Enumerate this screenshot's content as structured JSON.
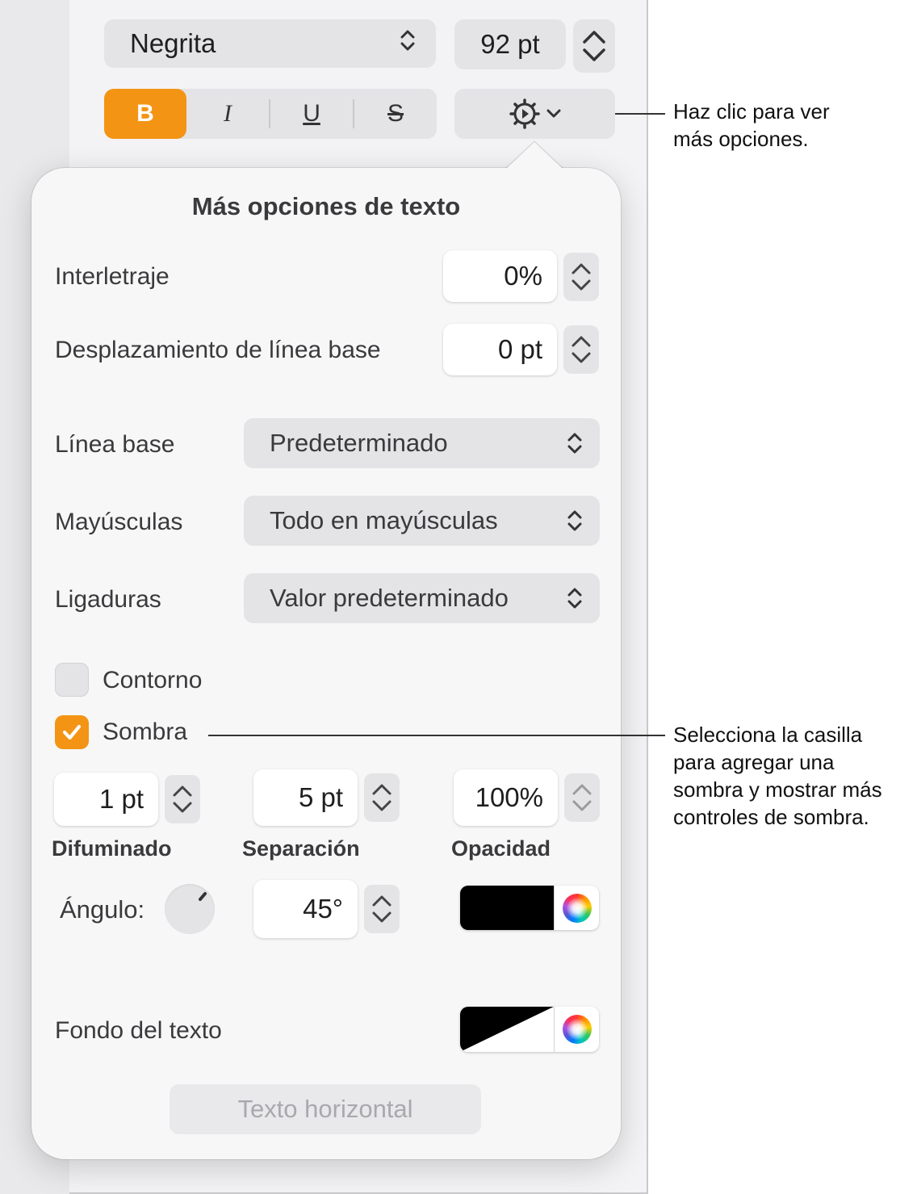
{
  "toolbar": {
    "font_style": "Negrita",
    "font_size": "92 pt",
    "bold_label": "B",
    "italic_label": "I",
    "underline_label": "U",
    "strikethrough_label": "S",
    "active_style": "bold"
  },
  "popover": {
    "title": "Más opciones de texto",
    "character_spacing": {
      "label": "Interletraje",
      "value": "0%"
    },
    "baseline_shift": {
      "label": "Desplazamiento de línea base",
      "value": "0 pt"
    },
    "baseline": {
      "label": "Línea base",
      "value": "Predeterminado"
    },
    "capitalization": {
      "label": "Mayúsculas",
      "value": "Todo en mayúsculas"
    },
    "ligatures": {
      "label": "Ligaduras",
      "value": "Valor predeterminado"
    },
    "outline": {
      "label": "Contorno",
      "checked": false
    },
    "shadow": {
      "label": "Sombra",
      "checked": true,
      "blur": {
        "label": "Difuminado",
        "value": "1 pt"
      },
      "offset": {
        "label": "Separación",
        "value": "5 pt"
      },
      "opacity": {
        "label": "Opacidad",
        "value": "100%"
      },
      "angle": {
        "label": "Ángulo:",
        "value": "45°"
      },
      "color": "#000000"
    },
    "text_background": {
      "label": "Fondo del texto",
      "color": "#000000",
      "partially_filled": true
    },
    "horizontal_text_button": "Texto horizontal"
  },
  "callouts": [
    {
      "line1": "Haz clic para ver",
      "line2": "más opciones."
    },
    {
      "line1": "Selecciona la casilla",
      "line2": "para agregar una",
      "line3": "sombra y mostrar más",
      "line4": "controles de sombra."
    }
  ],
  "colors": {
    "accent": "#f39414",
    "panel": "#f3f3f5",
    "popover": "#f7f7f8"
  },
  "icons": {
    "more_options": "gear-with-chevron-icon",
    "color_picker": "color-wheel-icon"
  }
}
